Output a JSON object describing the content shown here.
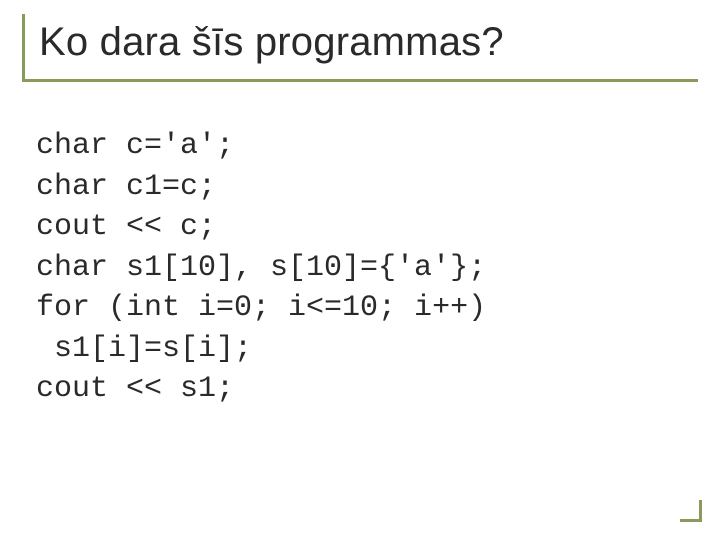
{
  "title": "Ko dara šīs programmas?",
  "code": {
    "l1": "char c='a';",
    "l2": "char c1=c;",
    "l3": "cout << c;",
    "l4": "char s1[10], s[10]={'a'};",
    "l5": "for (int i=0; i<=10; i++)",
    "l6": " s1[i]=s[i];",
    "l7": "cout << s1;"
  }
}
